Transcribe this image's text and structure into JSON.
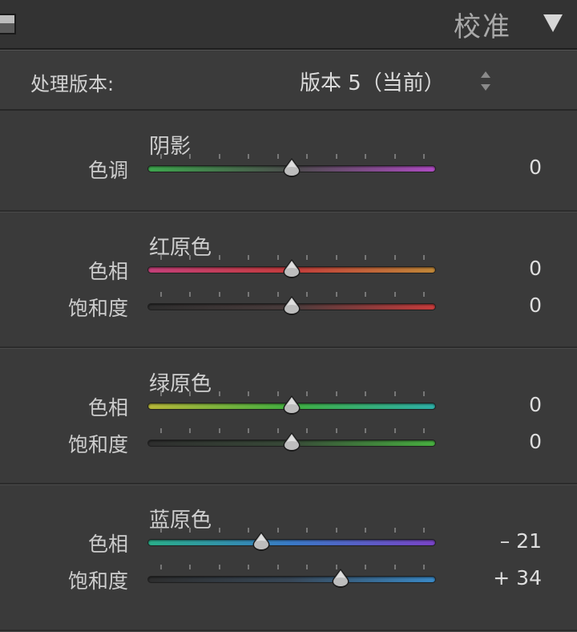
{
  "header": {
    "title": "校准"
  },
  "process": {
    "label": "处理版本:",
    "value": "版本 5（当前）"
  },
  "sections": [
    {
      "title": "阴影",
      "rows": [
        {
          "label": "色调",
          "value": "0",
          "amount": 0,
          "gradient": [
            "#3ea84e",
            "#4c4c4c",
            "#b04cc4"
          ]
        }
      ]
    },
    {
      "title": "红原色",
      "rows": [
        {
          "label": "色相",
          "value": "0",
          "amount": 0,
          "gradient": [
            "#c4407a",
            "#c43c3c",
            "#c08838"
          ]
        },
        {
          "label": "饱和度",
          "value": "0",
          "amount": 0,
          "gradient": [
            "#2e2e2e",
            "#4a3c3c",
            "#c83c3c"
          ]
        }
      ]
    },
    {
      "title": "绿原色",
      "rows": [
        {
          "label": "色相",
          "value": "0",
          "amount": 0,
          "gradient": [
            "#b8b83a",
            "#40b040",
            "#2eb0a8"
          ]
        },
        {
          "label": "饱和度",
          "value": "0",
          "amount": 0,
          "gradient": [
            "#2e2e2e",
            "#384a38",
            "#48b040"
          ]
        }
      ]
    },
    {
      "title": "蓝原色",
      "rows": [
        {
          "label": "色相",
          "value": "– 21",
          "amount": -21,
          "gradient": [
            "#2ab08a",
            "#3a7ac8",
            "#7a44c8"
          ]
        },
        {
          "label": "饱和度",
          "value": "+ 34",
          "amount": 34,
          "gradient": [
            "#2e2e2e",
            "#384858",
            "#3a8ac8"
          ]
        }
      ]
    }
  ]
}
